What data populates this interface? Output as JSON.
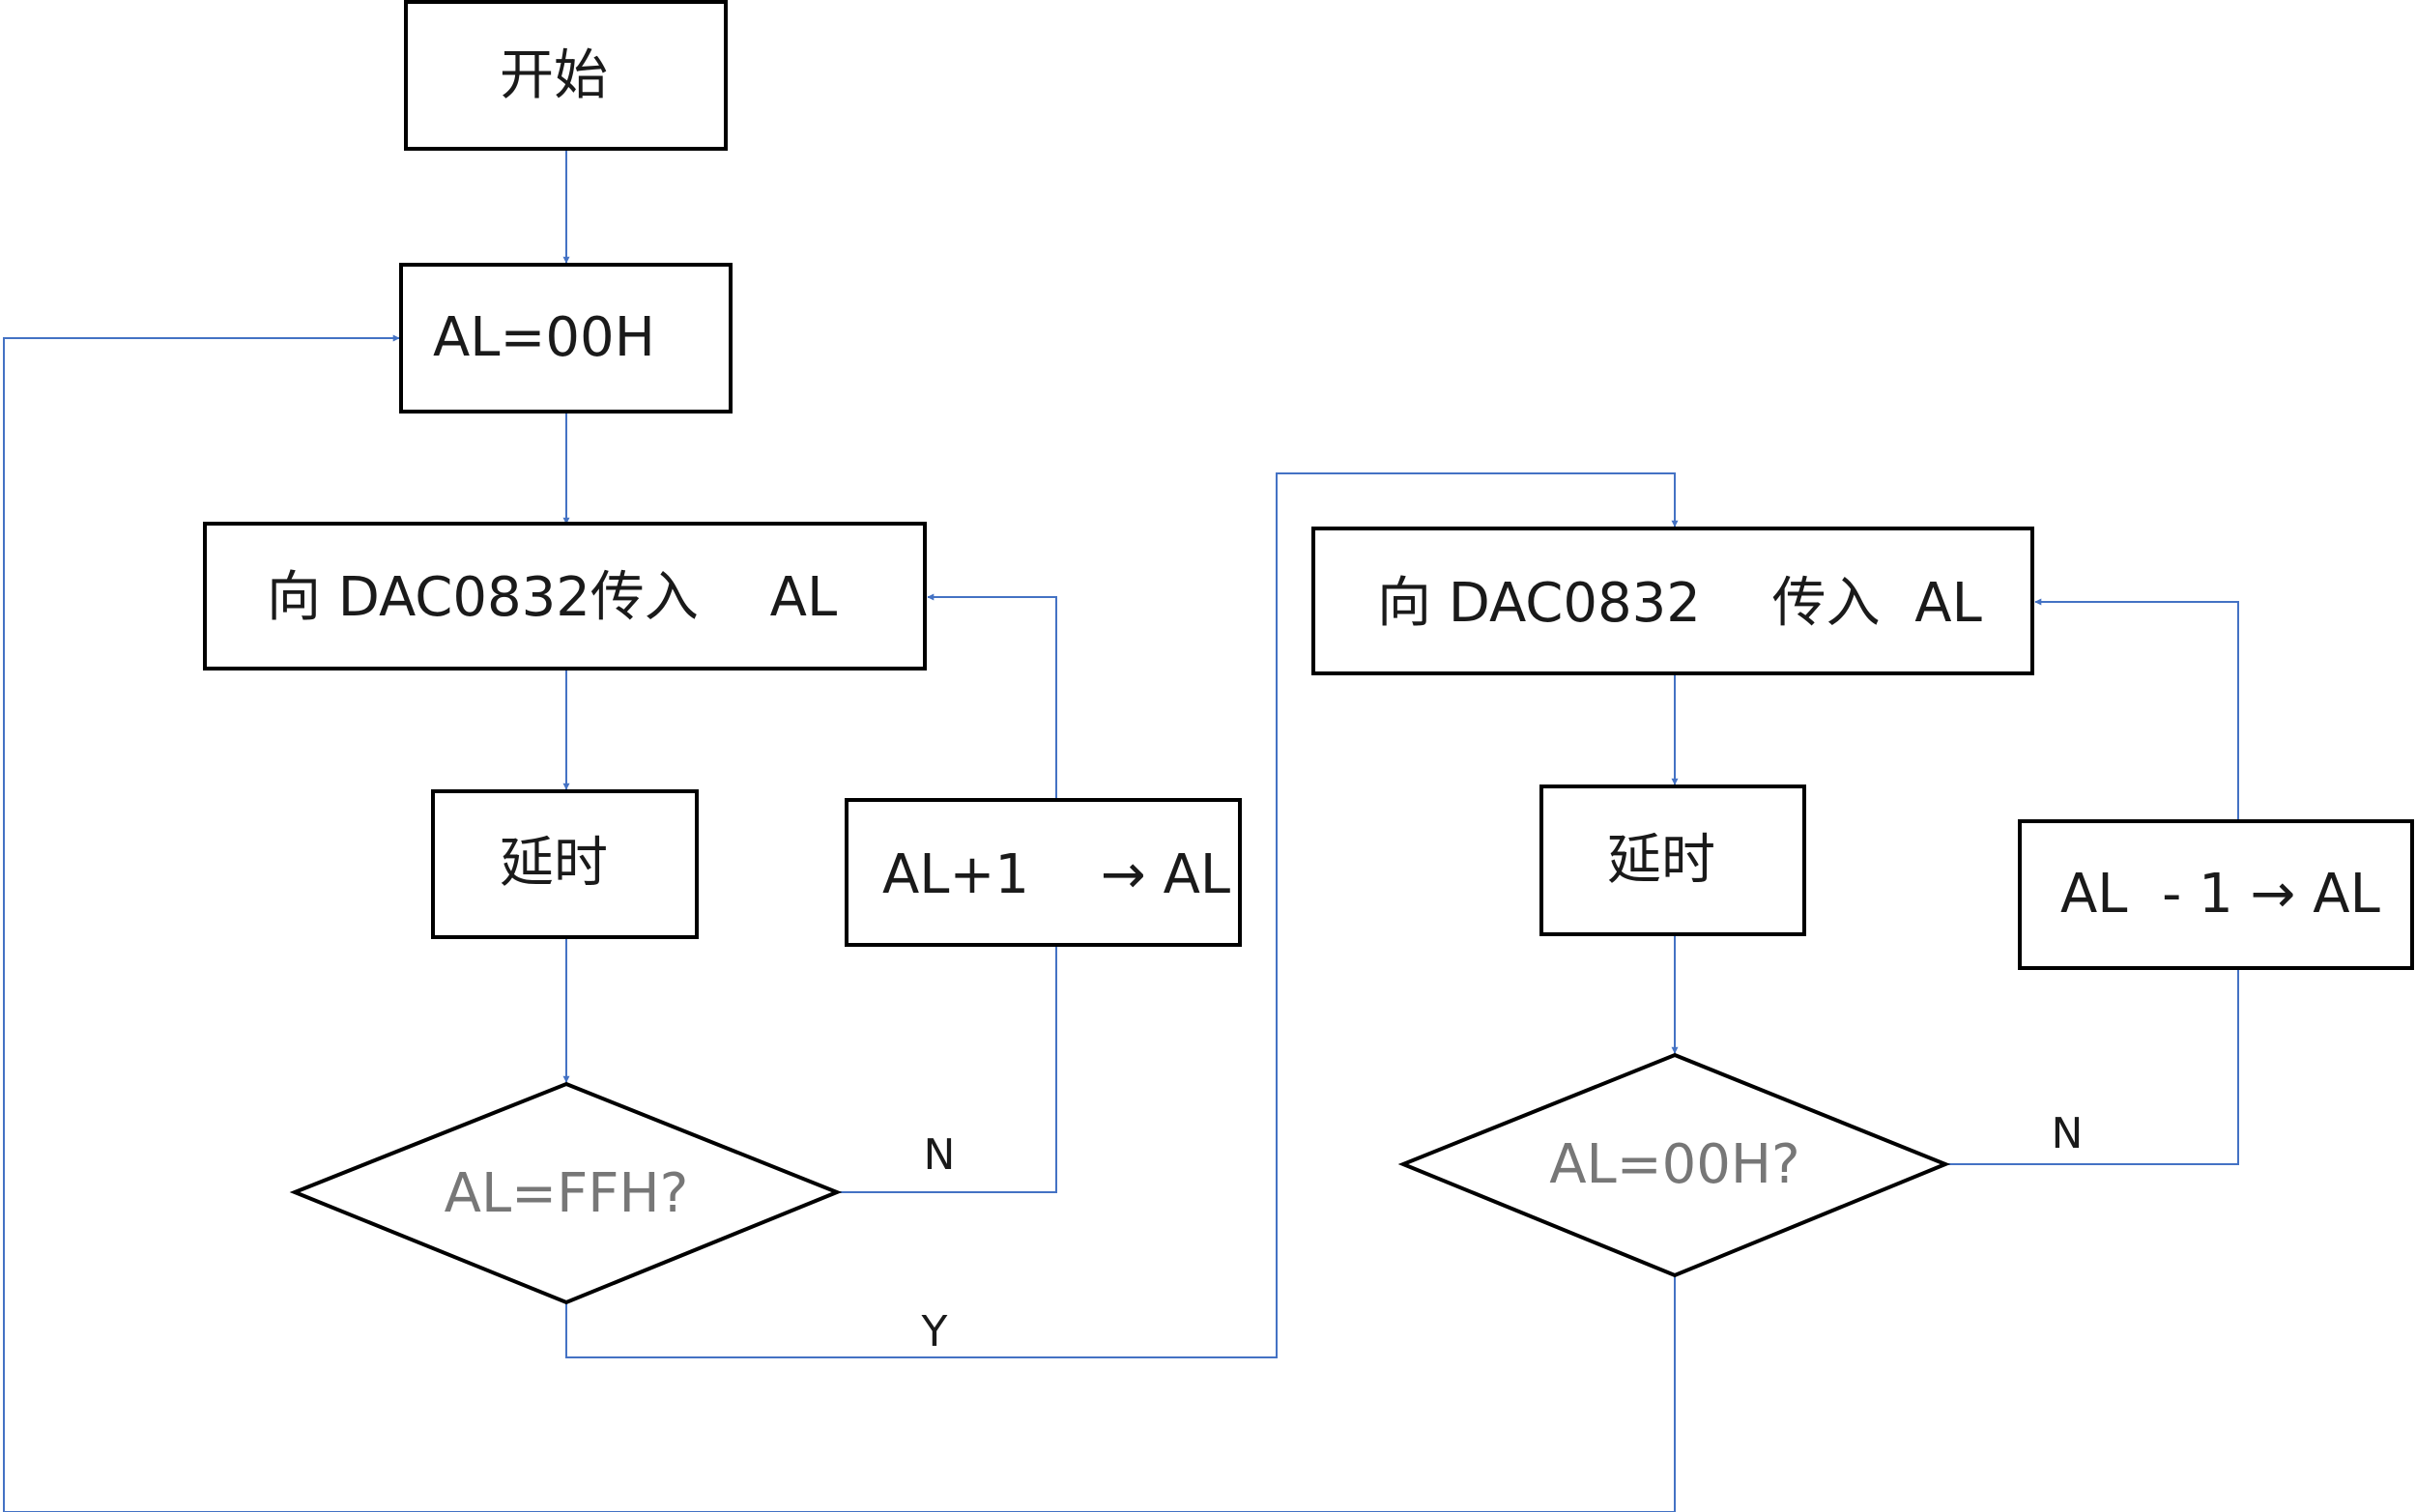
{
  "nodes": {
    "start": "开始",
    "init": "AL=00H",
    "send_up": "向 DAC0832传入　 AL",
    "delay_up": "延时",
    "inc": "AL+1 　→ AL",
    "check_ff": "AL=FFH?",
    "send_down": "向 DAC0832　 传入  AL",
    "delay_down": "延时",
    "dec": "AL  - 1 → AL",
    "check_00": "AL=00H?"
  },
  "edge_labels": {
    "ff_no": "N",
    "ff_yes": "Y",
    "zero_no": "N"
  },
  "colors": {
    "connector": "#4472C4",
    "node_border": "#000000",
    "condition_text": "#777777"
  }
}
